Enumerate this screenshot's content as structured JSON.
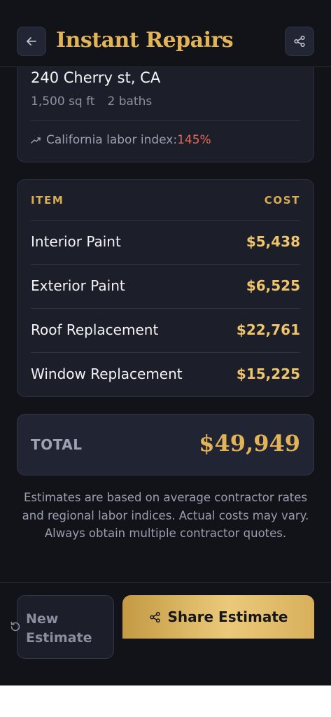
{
  "header": {
    "title": "Instant Repairs",
    "back_icon": "arrow-left-icon",
    "share_icon": "share-icon"
  },
  "property": {
    "address": "240 Cherry st, CA",
    "sqft": "1,500 sq ft",
    "baths": "2 baths",
    "labor_label": "California labor index: ",
    "labor_value": "145%",
    "labor_icon": "trending-up-icon"
  },
  "table": {
    "item_header": "ITEM",
    "cost_header": "COST",
    "rows": [
      {
        "name": "Interior Paint",
        "cost": "$5,438"
      },
      {
        "name": "Exterior Paint",
        "cost": "$6,525"
      },
      {
        "name": "Roof Replacement",
        "cost": "$22,761"
      },
      {
        "name": "Window Replacement",
        "cost": "$15,225"
      }
    ]
  },
  "total": {
    "label": "TOTAL",
    "value": "$49,949"
  },
  "disclaimer": "Estimates are based on average contractor rates and regional labor indices. Actual costs may vary. Always obtain multiple contractor quotes.",
  "footer": {
    "new_label": "New Estimate",
    "new_icon": "refresh-icon",
    "share_label": "Share Estimate",
    "share_icon": "share-icon"
  },
  "colors": {
    "background": "#121319",
    "card": "#1c1e29",
    "accent_gold": "#e2b457",
    "labor_red": "#e86a55"
  }
}
